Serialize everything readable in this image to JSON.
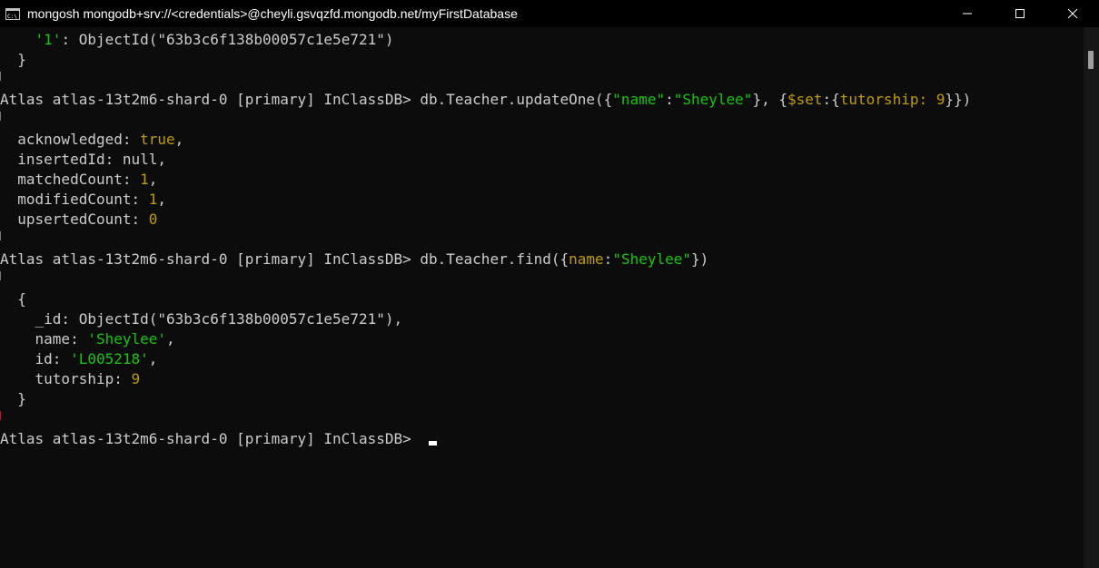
{
  "window": {
    "title": "mongosh mongodb+srv://<credentials>@cheyli.gsvqzfd.mongodb.net/myFirstDatabase",
    "icon": "terminal-icon",
    "controls": [
      "minimize-icon",
      "maximize-icon",
      "close-icon"
    ]
  },
  "colors": {
    "background": "#0c0c0c",
    "default_text": "#cccccc",
    "string": "#16c60c",
    "value": "#c19c00"
  },
  "terminal": {
    "line0": {
      "indent": "    ",
      "key": "'1'",
      "rest": ": ObjectId(\"63b3c6f138b00057c1e5e721\")"
    },
    "line1": {
      "text": "  }"
    },
    "cmd1": {
      "prompt": "Atlas atlas-13t2m6-shard-0 [primary] InClassDB> ",
      "p1": "db.Teacher.updateOne({",
      "p2": "\"name\"",
      "p3": ":",
      "p4": "\"Sheylee\"",
      "p5": "}, {",
      "p6": "$set",
      "p7": ":{",
      "p8": "tutorship",
      "p9": ": ",
      "p10": "9",
      "p11": "}})"
    },
    "result1": {
      "open": "{",
      "acknowledged_key": "  acknowledged: ",
      "acknowledged_val": "true",
      "acknowledged_end": ",",
      "insertedId_key": "  insertedId: ",
      "insertedId_val": "null",
      "insertedId_end": ",",
      "matched_key": "  matchedCount: ",
      "matched_val": "1",
      "matched_end": ",",
      "modified_key": "  modifiedCount: ",
      "modified_val": "1",
      "modified_end": ",",
      "upserted_key": "  upsertedCount: ",
      "upserted_val": "0",
      "close": "}"
    },
    "cmd2": {
      "prompt": "Atlas atlas-13t2m6-shard-0 [primary] InClassDB> ",
      "p1": "db.Teacher.find({",
      "p2": "name",
      "p3": ":",
      "p4": "\"Sheylee\"",
      "p5": "})"
    },
    "result2": {
      "open_arr": "[",
      "open_obj": "  {",
      "id_line": "    _id: ObjectId(\"63b3c6f138b00057c1e5e721\"),",
      "name_key": "    name: ",
      "name_val": "'Sheylee'",
      "name_end": ",",
      "idf_key": "    id: ",
      "idf_val": "'L005218'",
      "idf_end": ",",
      "tut_key": "    tutorship: ",
      "tut_val": "9",
      "close_obj": "  }",
      "close_arr": "]"
    },
    "cmd3": {
      "prompt": "Atlas atlas-13t2m6-shard-0 [primary] InClassDB> "
    }
  }
}
